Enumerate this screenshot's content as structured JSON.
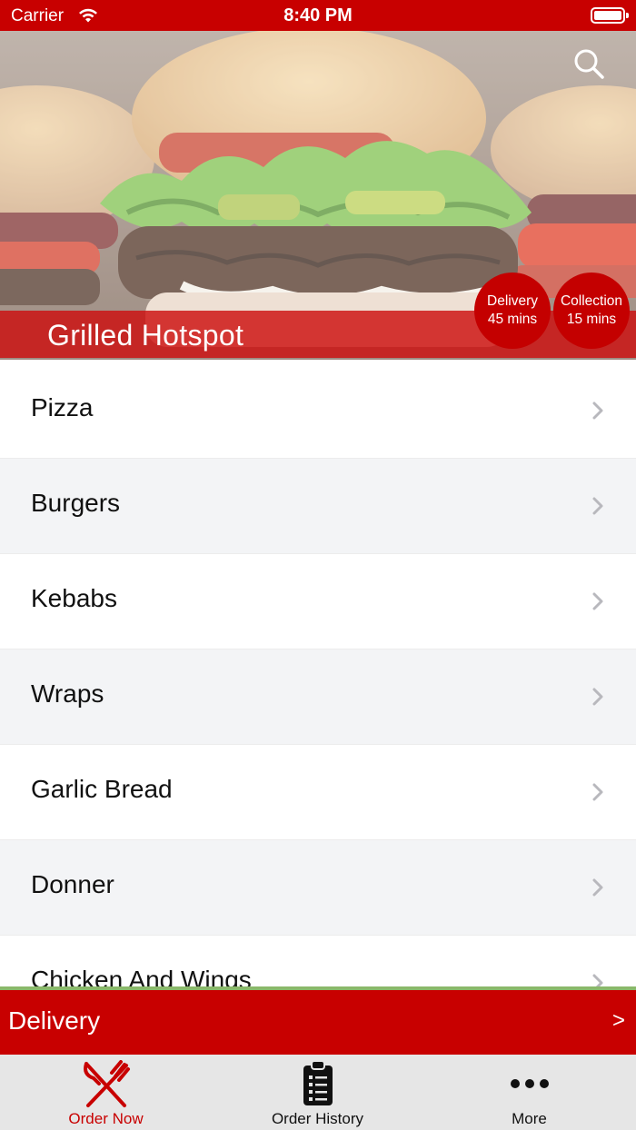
{
  "status_bar": {
    "carrier": "Carrier",
    "time": "8:40 PM"
  },
  "hero": {
    "restaurant_name": "Grilled Hotspot",
    "delivery": {
      "label": "Delivery",
      "time": "45 mins"
    },
    "collection": {
      "label": "Collection",
      "time": "15 mins"
    }
  },
  "categories": [
    {
      "label": "Pizza"
    },
    {
      "label": "Burgers"
    },
    {
      "label": "Kebabs"
    },
    {
      "label": "Wraps"
    },
    {
      "label": "Garlic Bread"
    },
    {
      "label": "Donner"
    },
    {
      "label": "Chicken And Wings"
    }
  ],
  "delivery_bar": {
    "label": "Delivery",
    "arrow": ">"
  },
  "tabs": [
    {
      "label": "Order Now",
      "icon": "fork-knife-icon"
    },
    {
      "label": "Order History",
      "icon": "clipboard-icon"
    },
    {
      "label": "More",
      "icon": "more-dots-icon"
    }
  ],
  "colors": {
    "accent": "#c80000",
    "tab_bar": "#e6e6e6",
    "alt_row": "#f3f4f6"
  }
}
